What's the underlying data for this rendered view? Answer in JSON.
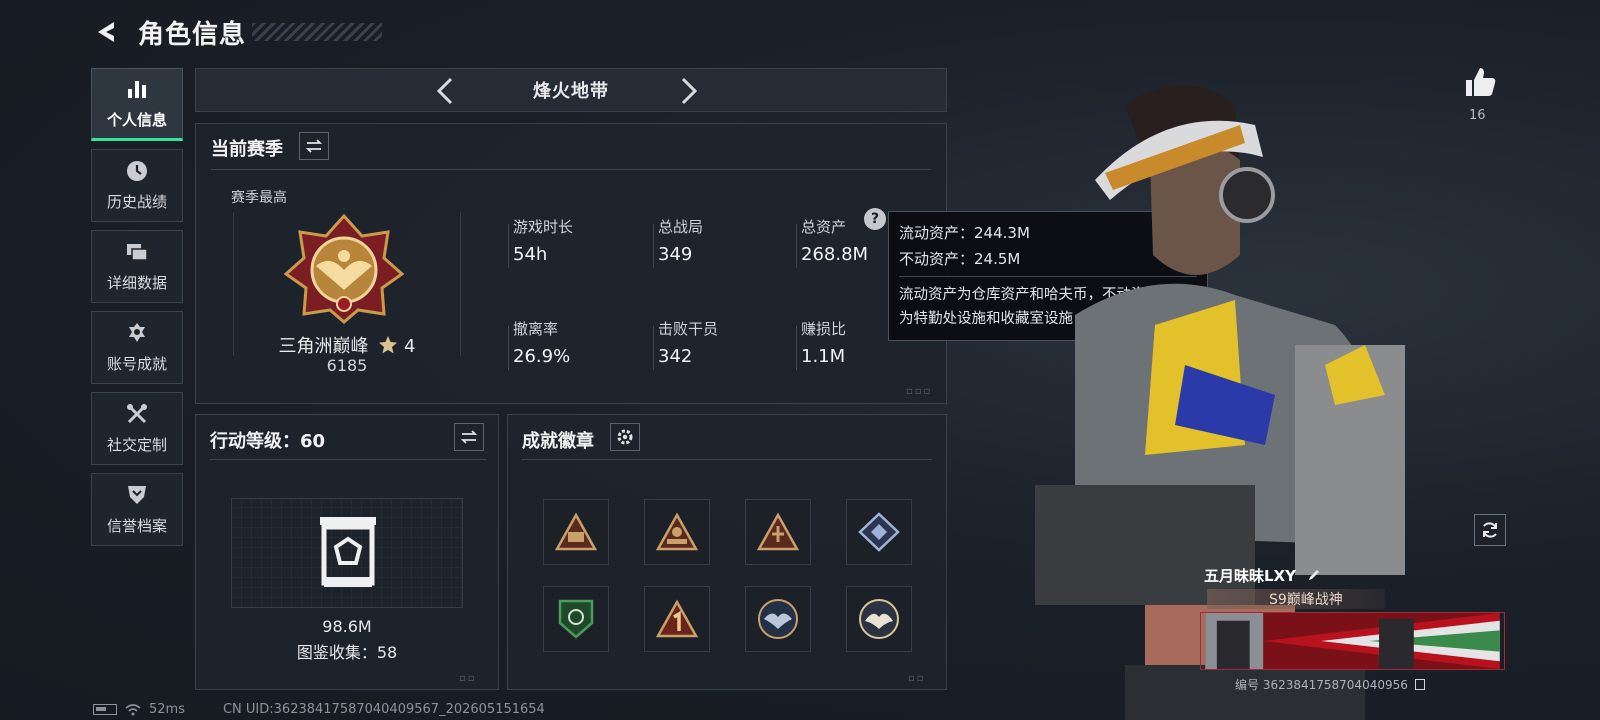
{
  "header": {
    "title": "角色信息"
  },
  "sidebar": {
    "items": [
      {
        "label": "个人信息",
        "icon": "bar-chart-icon",
        "active": true
      },
      {
        "label": "历史战绩",
        "icon": "clock-icon"
      },
      {
        "label": "详细数据",
        "icon": "folders-icon"
      },
      {
        "label": "账号成就",
        "icon": "achievement-icon"
      },
      {
        "label": "社交定制",
        "icon": "tools-icon"
      },
      {
        "label": "信誉档案",
        "icon": "shield-chevron-icon"
      }
    ]
  },
  "mode": {
    "title": "烽火地带"
  },
  "season": {
    "title": "当前赛季",
    "best_label": "赛季最高",
    "rank_name": "三角洲巅峰",
    "rank_stars": "4",
    "rank_score": "6185",
    "stats": [
      {
        "label": "游戏时长",
        "value": "54h"
      },
      {
        "label": "总战局",
        "value": "349"
      },
      {
        "label": "总资产",
        "value": "268.8M"
      },
      {
        "label": "撤离率",
        "value": "26.9%"
      },
      {
        "label": "击败干员",
        "value": "342"
      },
      {
        "label": "赚损比",
        "value": "1.1M"
      }
    ]
  },
  "tooltip": {
    "liquid": "流动资产：244.3M",
    "fixed": "不动资产：24.5M",
    "desc_line1": "流动资产为仓库资产和哈夫币，不动资产",
    "desc_line2": "为特勤处设施和收藏室设施"
  },
  "level": {
    "title": "行动等级：60",
    "value": "98.6M",
    "collection": "图鉴收集：58"
  },
  "badges": {
    "title": "成就徽章",
    "items": [
      {
        "icon": "triangle-emblem-icon",
        "color": "#c9a06a"
      },
      {
        "icon": "soldier-emblem-icon",
        "color": "#c9a06a"
      },
      {
        "icon": "figure-emblem-icon",
        "color": "#c9a06a"
      },
      {
        "icon": "diamond-emblem-icon",
        "color": "#9fb3d9"
      },
      {
        "icon": "green-shield-emblem-icon",
        "color": "#4a9a5a"
      },
      {
        "icon": "number-one-emblem-icon",
        "color": "#c9a06a"
      },
      {
        "icon": "eagle-emblem-icon",
        "color": "#b9c6dc"
      },
      {
        "icon": "eagle-gold-emblem-icon",
        "color": "#d9c39a"
      }
    ]
  },
  "character": {
    "likes": "16",
    "name": "五月昧昧LXY",
    "rank_title": "S9巅峰战神",
    "uid": "编号 3623841758704040956"
  },
  "status": {
    "ping": "52ms",
    "uid": "CN UID:3623841758704040956​7_202605151654"
  },
  "colors": {
    "accent": "#35e39a",
    "panel": "#1e242c",
    "tooltip_bg": "#0a0c10"
  }
}
